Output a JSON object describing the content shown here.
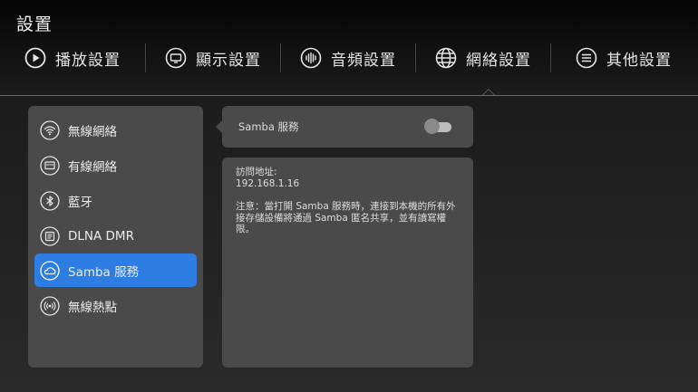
{
  "header": {
    "title": "設置"
  },
  "tabs": [
    {
      "label": "播放設置",
      "icon": "play-circle-icon"
    },
    {
      "label": "顯示設置",
      "icon": "monitor-icon"
    },
    {
      "label": "音頻設置",
      "icon": "audio-wave-icon"
    },
    {
      "label": "網絡設置",
      "icon": "globe-icon",
      "selected": true
    },
    {
      "label": "其他設置",
      "icon": "menu-lines-icon"
    }
  ],
  "sidebar": {
    "items": [
      {
        "label": "無線網絡",
        "icon": "wifi-icon"
      },
      {
        "label": "有線網絡",
        "icon": "ethernet-icon"
      },
      {
        "label": "藍牙",
        "icon": "bluetooth-icon"
      },
      {
        "label": "DLNA DMR",
        "icon": "dlna-icon"
      },
      {
        "label": "Samba 服務",
        "icon": "cloud-icon",
        "selected": true
      },
      {
        "label": "無線熱點",
        "icon": "hotspot-icon"
      }
    ]
  },
  "samba": {
    "label": "Samba 服務",
    "enabled": false
  },
  "info": {
    "address_label": "訪問地址:",
    "address_value": "192.168.1.16",
    "note": "注意：當打開 Samba 服務時，連接到本機的所有外接存儲設備將通過 Samba 匿名共享，並有讀寫權限。"
  },
  "colors": {
    "accent": "#2e7de2",
    "panel": "#4a4a4a"
  }
}
